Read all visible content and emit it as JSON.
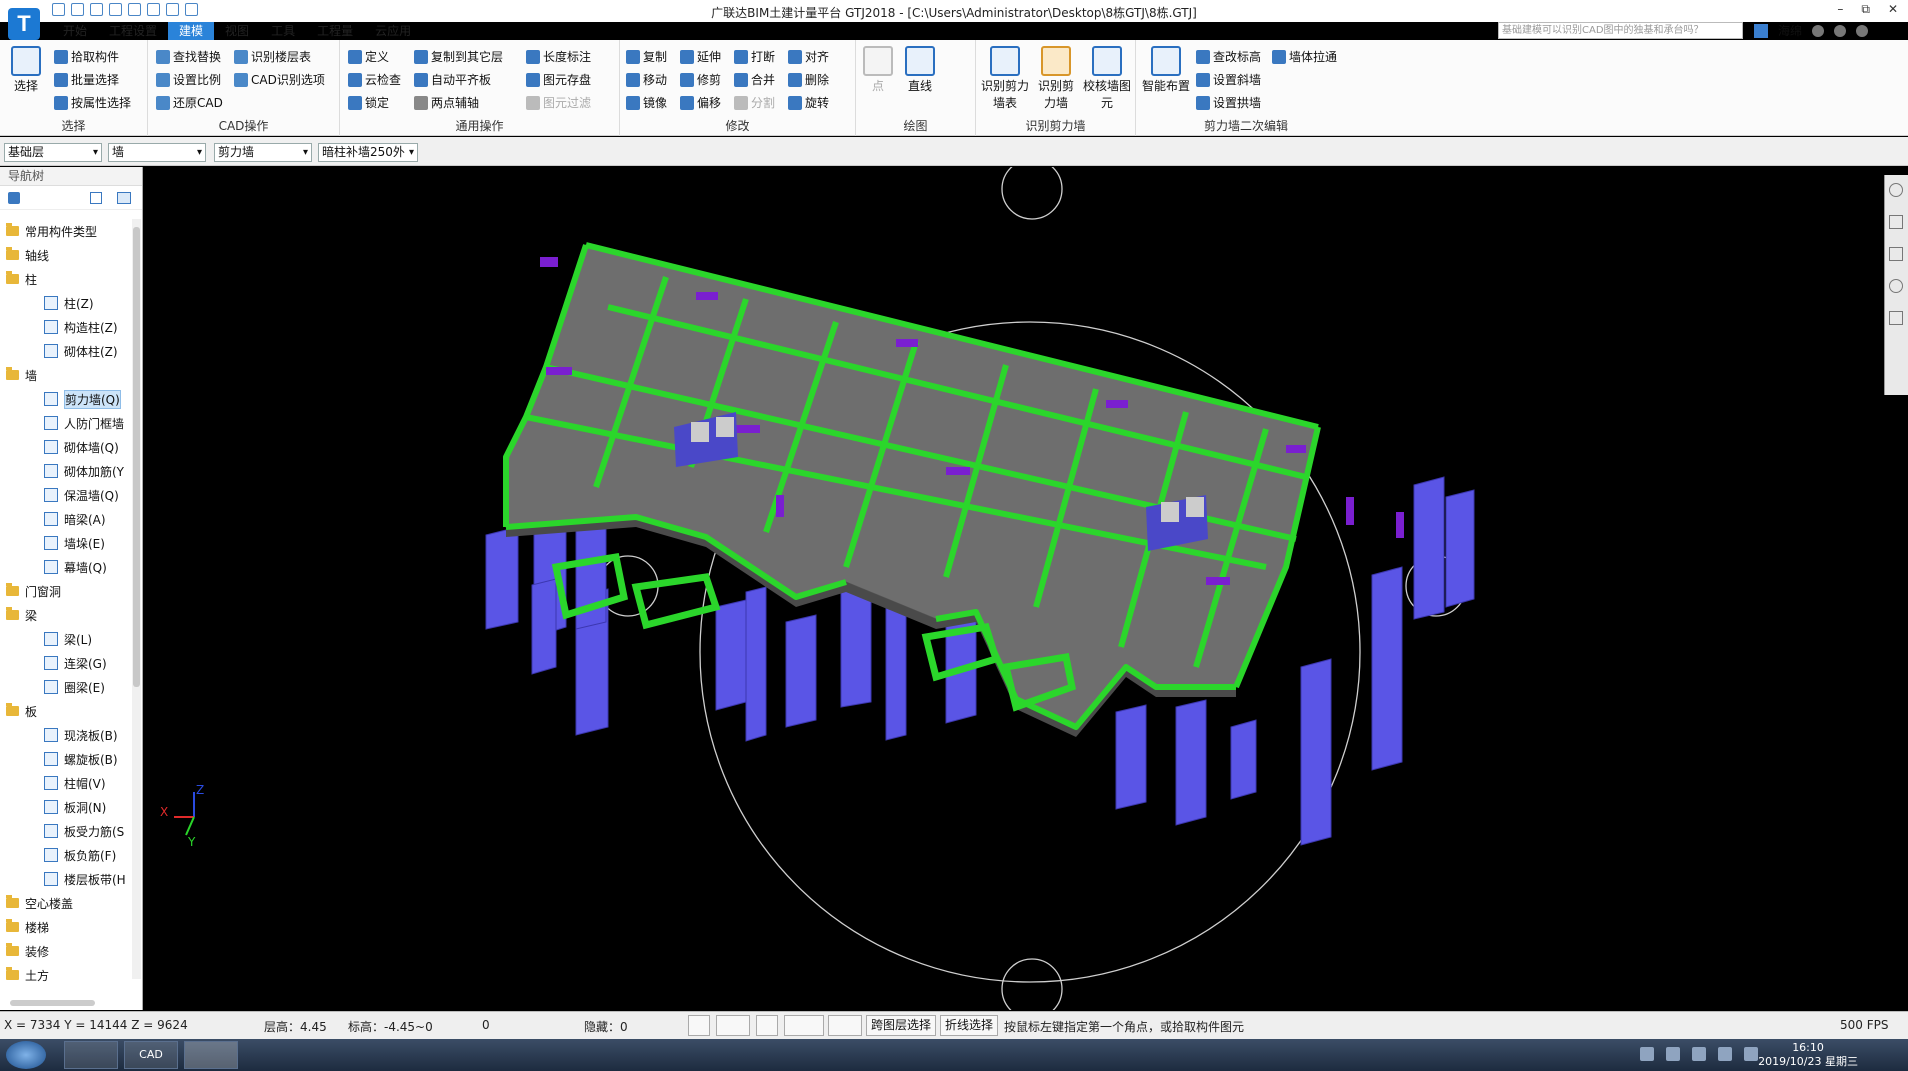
{
  "window": {
    "title": "广联达BIM土建计量平台 GTJ2018 - [C:\\Users\\Administrator\\Desktop\\8栋GTJ\\8栋.GTJ]",
    "logo": "T",
    "controls": [
      "–",
      "⧉",
      "✕"
    ]
  },
  "menu": {
    "items": [
      "开始",
      "工程设置",
      "建模",
      "视图",
      "工具",
      "工程量",
      "云应用"
    ],
    "active": "建模"
  },
  "search": {
    "placeholder": "基础建模可以识别CAD图中的独基和承台吗？"
  },
  "user": {
    "name": "海绵"
  },
  "ribbon": {
    "select": {
      "big": "选择",
      "items": [
        "拾取构件",
        "批量选择",
        "按属性选择"
      ],
      "label": "选择"
    },
    "cad": {
      "items": [
        "查找替换",
        "设置比例",
        "还原CAD",
        "识别楼层表",
        "CAD识别选项"
      ],
      "label": "CAD操作"
    },
    "general": {
      "items": [
        "定义",
        "云检查",
        "锁定",
        "复制到其它层",
        "自动平齐板",
        "两点辅轴",
        "长度标注",
        "图元存盘",
        "图元过滤"
      ],
      "label": "通用操作"
    },
    "modify": {
      "items": [
        "复制",
        "移动",
        "镜像",
        "延伸",
        "修剪",
        "偏移",
        "打断",
        "合并",
        "分割",
        "对齐",
        "删除",
        "旋转"
      ],
      "label": "修改"
    },
    "draw": {
      "items": [
        "点",
        "直线"
      ],
      "label": "绘图"
    },
    "recog": {
      "items": [
        "识别剪力墙表",
        "识别剪力墙",
        "校核墙图元"
      ],
      "label": "识别剪力墙"
    },
    "wall2": {
      "items": [
        "智能布置",
        "查改标高",
        "设置斜墙",
        "设置拱墙",
        "墙体拉通"
      ],
      "label": "剪力墙二次编辑"
    }
  },
  "props": {
    "floor": "基础层",
    "type": "墙",
    "subtype": "剪力墙",
    "member": "暗柱补墙250外"
  },
  "nav": {
    "title": "导航树",
    "tree": [
      {
        "label": "常用构件类型",
        "level": 0
      },
      {
        "label": "轴线",
        "level": 0
      },
      {
        "label": "柱",
        "level": 0
      },
      {
        "label": "柱(Z)",
        "level": 1
      },
      {
        "label": "构造柱(Z)",
        "level": 1
      },
      {
        "label": "砌体柱(Z)",
        "level": 1
      },
      {
        "label": "墙",
        "level": 0
      },
      {
        "label": "剪力墙(Q)",
        "level": 1,
        "selected": true
      },
      {
        "label": "人防门框墙",
        "level": 1
      },
      {
        "label": "砌体墙(Q)",
        "level": 1
      },
      {
        "label": "砌体加筋(Y",
        "level": 1
      },
      {
        "label": "保温墙(Q)",
        "level": 1
      },
      {
        "label": "暗梁(A)",
        "level": 1
      },
      {
        "label": "墙垛(E)",
        "level": 1
      },
      {
        "label": "幕墙(Q)",
        "level": 1
      },
      {
        "label": "门窗洞",
        "level": 0
      },
      {
        "label": "梁",
        "level": 0
      },
      {
        "label": "梁(L)",
        "level": 1
      },
      {
        "label": "连梁(G)",
        "level": 1
      },
      {
        "label": "圈梁(E)",
        "level": 1
      },
      {
        "label": "板",
        "level": 0
      },
      {
        "label": "现浇板(B)",
        "level": 1
      },
      {
        "label": "螺旋板(B)",
        "level": 1
      },
      {
        "label": "柱帽(V)",
        "level": 1
      },
      {
        "label": "板洞(N)",
        "level": 1
      },
      {
        "label": "板受力筋(S",
        "level": 1
      },
      {
        "label": "板负筋(F)",
        "level": 1
      },
      {
        "label": "楼层板带(H",
        "level": 1
      },
      {
        "label": "空心楼盖",
        "level": 0
      },
      {
        "label": "楼梯",
        "level": 0
      },
      {
        "label": "装修",
        "level": 0
      },
      {
        "label": "土方",
        "level": 0
      }
    ]
  },
  "axis": {
    "x": "X",
    "y": "Y",
    "z": "Z"
  },
  "status": {
    "coords": "X = 7334 Y = 14144 Z = 9624",
    "floor_height": "层高：4.45",
    "elevation": "标高：-4.45~0",
    "count": "0",
    "hidden": "隐藏：0",
    "cross_layer": "跨图层选择",
    "polyline": "折线选择",
    "hint": "按鼠标左键指定第一个角点，或拾取构件图元",
    "fps": "500 FPS"
  },
  "taskbar": {
    "time": "16:10",
    "date": "2019/10/23 星期三",
    "cad": "CAD"
  },
  "colors": {
    "slab": "#6e6e6e",
    "wall": "#2bd62b",
    "column": "#5a55e6",
    "hidden": "#7a1fd0"
  }
}
